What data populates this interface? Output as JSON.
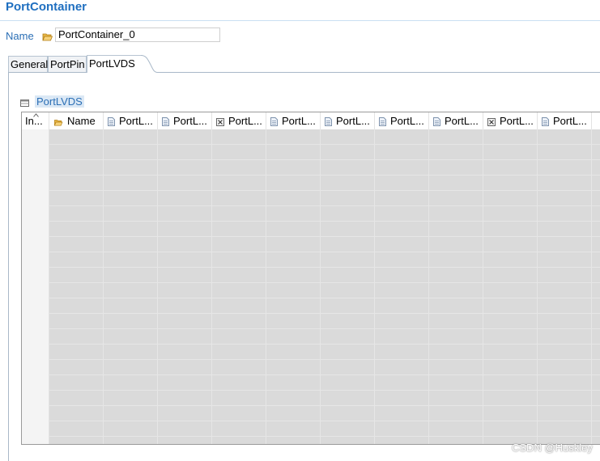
{
  "editor": {
    "title": "PortContainer",
    "name_label": "Name",
    "name_value": "PortContainer_0",
    "name_icon": "folder-open-icon"
  },
  "tabs": [
    {
      "label": "General",
      "active": false
    },
    {
      "label": "PortPin",
      "active": false
    },
    {
      "label": "PortLVDS",
      "active": true
    }
  ],
  "section": {
    "label": "PortLVDS",
    "icon": "table-icon"
  },
  "table": {
    "columns": [
      {
        "label": "In...",
        "icon": "none"
      },
      {
        "label": "Name",
        "icon": "folder-open-icon"
      },
      {
        "label": "PortL...",
        "icon": "document-icon"
      },
      {
        "label": "PortL...",
        "icon": "document-icon"
      },
      {
        "label": "PortL...",
        "icon": "checkbox-icon"
      },
      {
        "label": "PortL...",
        "icon": "document-icon"
      },
      {
        "label": "PortL...",
        "icon": "document-icon"
      },
      {
        "label": "PortL...",
        "icon": "document-icon"
      },
      {
        "label": "PortL...",
        "icon": "document-icon"
      },
      {
        "label": "PortL...",
        "icon": "checkbox-icon"
      },
      {
        "label": "PortL...",
        "icon": "document-icon"
      }
    ]
  },
  "colors": {
    "title": "#1f6fc0",
    "link": "#2b6fb5",
    "row_fill": "#dadada"
  },
  "watermark": "CSDN @Huskley"
}
